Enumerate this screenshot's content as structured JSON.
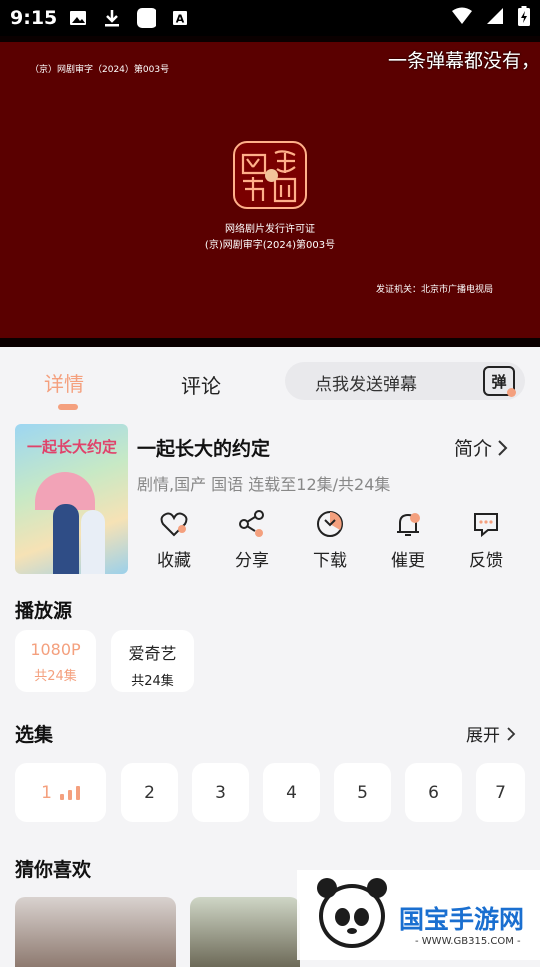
{
  "status_bar": {
    "time": "9:15"
  },
  "player": {
    "danmaku_text": "一条弹幕都没有，",
    "license_top": "（京）网剧审字（2024）第003号",
    "license_line1": "网络剧片发行许可证",
    "license_line2": "(京)网剧审字(2024)第003号",
    "issuer": "发证机关：北京市广播电视局",
    "seal_text": "网络视听"
  },
  "tabs": {
    "detail": "详情",
    "comment": "评论"
  },
  "danmaku_input": {
    "placeholder": "点我发送弹幕",
    "icon_label": "弹"
  },
  "show": {
    "title": "一起长大的约定",
    "intro_label": "简介",
    "meta": "剧情,国产 国语 连载至12集/共24集",
    "poster_title": "一起长大约定"
  },
  "actions": [
    {
      "label": "收藏",
      "icon": "heart-icon"
    },
    {
      "label": "分享",
      "icon": "share-icon"
    },
    {
      "label": "下载",
      "icon": "download-icon"
    },
    {
      "label": "催更",
      "icon": "bell-icon"
    },
    {
      "label": "反馈",
      "icon": "feedback-icon"
    }
  ],
  "sources": {
    "heading": "播放源",
    "items": [
      {
        "name": "1080P",
        "count": "共24集",
        "color": "#f4a07e"
      },
      {
        "name": "爱奇艺",
        "count": "共24集",
        "color": "#222222"
      }
    ]
  },
  "episodes": {
    "heading": "选集",
    "expand_label": "展开",
    "items": [
      "1",
      "2",
      "3",
      "4",
      "5",
      "6",
      "7"
    ]
  },
  "recommend": {
    "heading": "猜你喜欢"
  },
  "watermark": {
    "title": "国宝手游网",
    "subtitle": "- WWW.GB315.COM -"
  },
  "colors": {
    "accent": "#f4a07e",
    "player_bg": "#5a0000"
  }
}
